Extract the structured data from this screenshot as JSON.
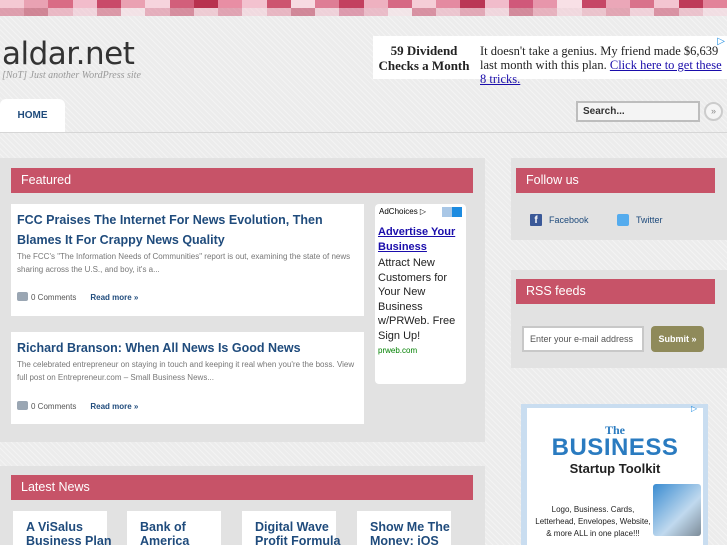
{
  "colors": {
    "accent": "#c75368",
    "link": "#1f4b7c",
    "submit": "#8f8a5a",
    "strip": [
      "#f4c9d3",
      "#e9a2b3",
      "#d96c85",
      "#f2bccb",
      "#c94a69",
      "#eaa1b2",
      "#f6d4dd",
      "#d25f7b",
      "#b8324f",
      "#e88ea4",
      "#f3c2cf",
      "#cd546f",
      "#f7dbe2",
      "#de7d95",
      "#c3405f",
      "#eeb1c0",
      "#d66984",
      "#f5cdd7",
      "#e48aa1",
      "#ba3655",
      "#f1bccb",
      "#d0587a",
      "#e796ab",
      "#f8e0e6",
      "#c64766",
      "#eba7b8",
      "#d9728b",
      "#f3c5d1",
      "#be3b59",
      "#e28399"
    ]
  },
  "site": {
    "title": "aldar.net",
    "tagline": "[NoT] Just another WordPress site"
  },
  "top_ad": {
    "headline_line1": "59 Dividend",
    "headline_line2": "Checks a Month",
    "body": "It doesn't take a genius. My friend made $6,639 last month with this plan.",
    "link_text": "Click here to get these 8 tricks."
  },
  "nav": {
    "home": "HOME"
  },
  "search": {
    "placeholder": "Search...",
    "button": "»"
  },
  "featured": {
    "heading": "Featured",
    "posts": [
      {
        "title": "FCC Praises The Internet For News Evolution, Then Blames It For Crappy News Quality",
        "excerpt": "The FCC's \"The Information Needs of Communities\" report is out, examining the state of news sharing across the U.S., and boy, it's a...",
        "comments": "0 Comments",
        "read_more": "Read more »"
      },
      {
        "title": "Richard Branson: When All News Is Good News",
        "excerpt": "The celebrated entrepreneur on staying in touch and keeping it real when you're the boss. View full post on Entrepreneur.com – Small Business News...",
        "comments": "0 Comments",
        "read_more": "Read more »"
      }
    ]
  },
  "side_ad": {
    "adchoices": "AdChoices ▷",
    "title": "Advertise Your Business",
    "text": "Attract New Customers for Your New Business w/PRWeb. Free Sign Up!",
    "url": "prweb.com"
  },
  "follow": {
    "heading": "Follow us",
    "facebook": "Facebook",
    "twitter": "Twitter"
  },
  "rss": {
    "heading": "RSS feeds",
    "email_placeholder": "Enter your e-mail address",
    "submit": "Submit »"
  },
  "bottom_ad": {
    "the": "The",
    "business": "BUSINESS",
    "toolkit": "Startup Toolkit",
    "small_line1": "Logo, Business. Cards,",
    "small_line2": "Letterhead, Envelopes, Website,",
    "small_line3": "& more ALL in one place!!!",
    "badge": "▷"
  },
  "latest": {
    "heading": "Latest News",
    "items": [
      "A ViSalus\nBusiness Plan",
      "Bank of\nAmerica",
      "Digital Wave\nProfit Formula",
      "Show Me The\nMoney: iOS"
    ]
  }
}
